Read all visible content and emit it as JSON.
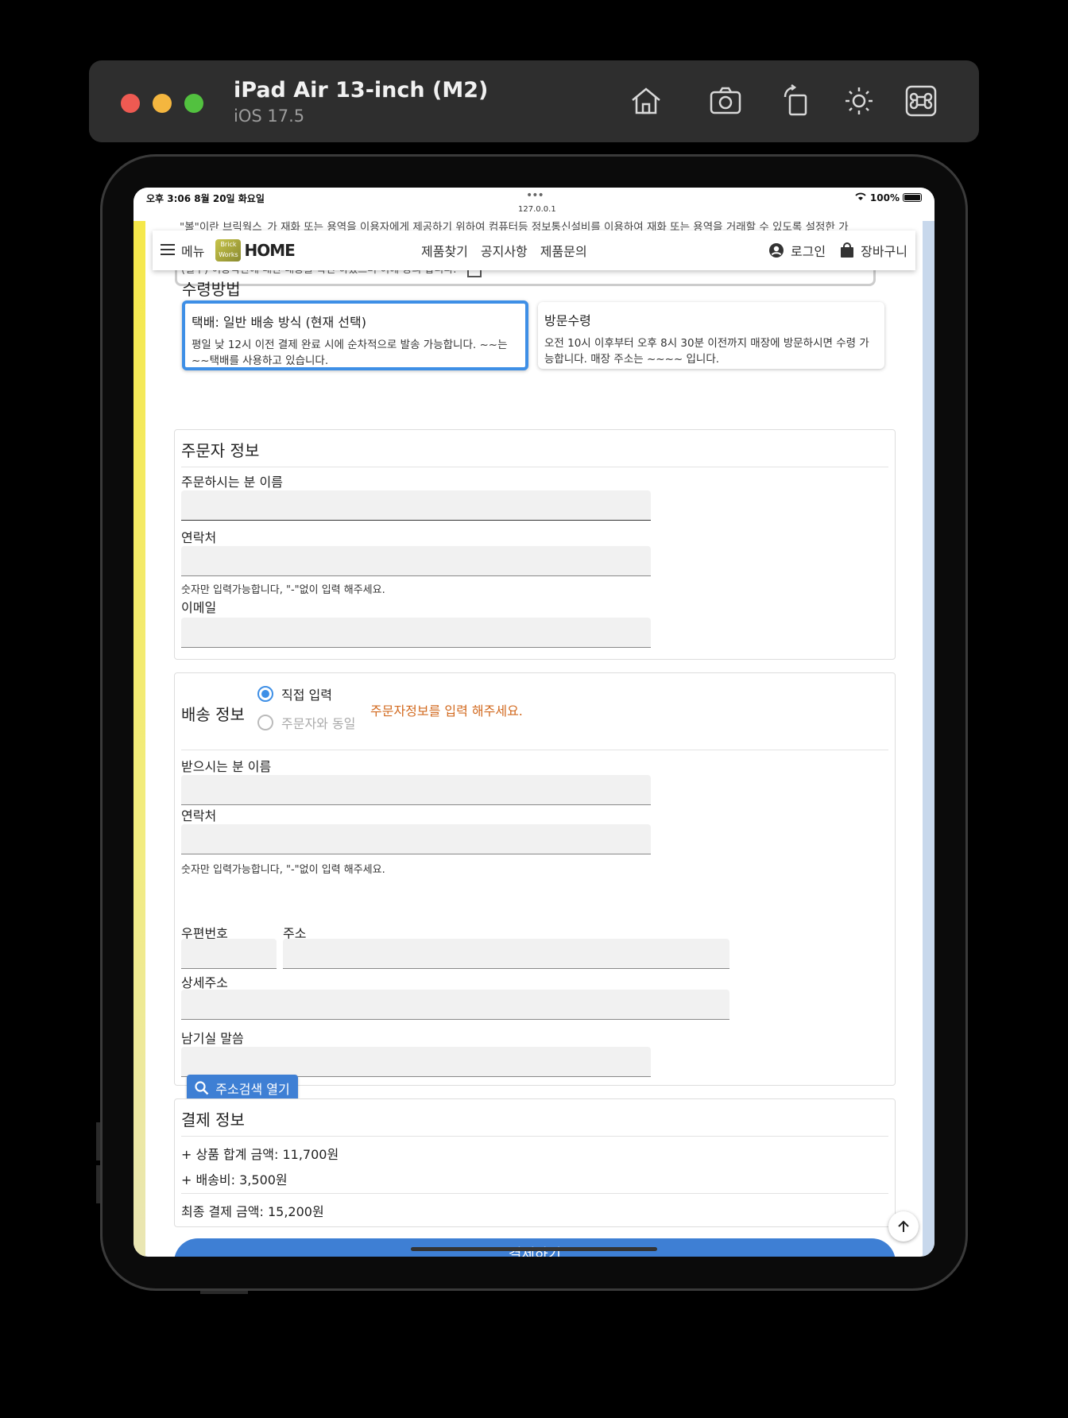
{
  "simulator": {
    "device_name": "iPad Air 13-inch (M2)",
    "os_version": "iOS 17.5",
    "icons": [
      "home-icon",
      "screenshot-icon",
      "rotate-icon",
      "brightness-icon",
      "command-icon"
    ]
  },
  "status_bar": {
    "time": "오후 3:06   8월 20일 화요일",
    "dots": "•••",
    "url": "127.0.0.1",
    "battery": "100%"
  },
  "terms": {
    "scrolled_text": "\"볼\"이란 브릭웍스_가 재화 또는 용역을 이용자에게 제공하기 위하여 컴퓨터등 정보통신설비를 이용하여 재화 또는 용역을 거래할 수 있도록 설정한 가",
    "agree_text": "(필수) 이용약관에 대한 내용을 확인 하였으며 이에 동의 합니다."
  },
  "nav": {
    "menu_label": "메뉴",
    "logo_text": "HOME",
    "logo_badge": "Brick Works",
    "links": [
      "제품찾기",
      "공지사항",
      "제품문의"
    ],
    "login": "로그인",
    "cart": "장바구니"
  },
  "receive": {
    "title": "수령방법",
    "options": [
      {
        "title": "택배: 일반 배송 방식 (현재 선택)",
        "desc": "평일 낮 12시 이전 결제 완료 시에 순차적으로 발송 가능합니다. ~~는 ~~택배를 사용하고 있습니다.",
        "selected": true
      },
      {
        "title": "방문수령",
        "desc": "오전 10시 이후부터 오후 8시 30분 이전까지 매장에 방문하시면 수령 가능합니다. 매장 주소는 ~~~~ 입니다.",
        "selected": false
      }
    ]
  },
  "orderer": {
    "title": "주문자 정보",
    "name_label": "주문하시는 분 이름",
    "phone_label": "연락처",
    "phone_hint": "숫자만 입력가능합니다, \"-\"없이 입력 해주세요.",
    "email_label": "이메일"
  },
  "shipping": {
    "title": "배송 정보",
    "radio_direct": "직접 입력",
    "radio_same": "주문자와 동일",
    "warning": "주문자정보를 입력 해주세요.",
    "warning_color": "#d2691e",
    "name_label": "받으시는 분 이름",
    "phone_label": "연락처",
    "phone_hint": "숫자만 입력가능합니다, \"-\"없이 입력 해주세요.",
    "search_button": "주소검색 열기",
    "zip_label": "우편번호",
    "address_label": "주소",
    "detail_label": "상세주소",
    "message_label": "남기실 말씀"
  },
  "payment": {
    "title": "결제 정보",
    "subtotal": "+ 상품 합계 금액: 11,700원",
    "shipping_fee": "+ 배송비: 3,500원",
    "total": "최종 결제 금액: 15,200원",
    "pay_button": "결제하기"
  },
  "colors": {
    "accent": "#3e8fe6",
    "button": "#3e7fd4"
  }
}
